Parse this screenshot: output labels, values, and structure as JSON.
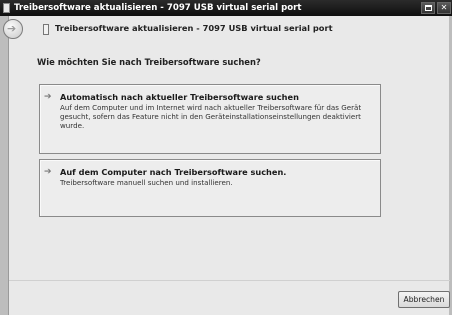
{
  "window": {
    "title": "Treibersoftware aktualisieren - 7097 USB virtual serial port"
  },
  "header": {
    "title": "Treibersoftware aktualisieren - 7097 USB virtual serial port"
  },
  "main": {
    "question": "Wie möchten Sie nach Treibersoftware suchen?",
    "options": [
      {
        "title": "Automatisch nach aktueller Treibersoftware suchen",
        "description": "Auf dem Computer und im Internet wird nach aktueller Treibersoftware für das Gerät gesucht, sofern das Feature nicht in den Geräteinstallationseinstellungen deaktiviert wurde."
      },
      {
        "title": "Auf dem Computer nach Treibersoftware suchen.",
        "description": "Treibersoftware manuell suchen und installieren."
      }
    ]
  },
  "footer": {
    "cancel_label": "Abbrechen"
  },
  "icons": {
    "back": "back-arrow-icon",
    "option_arrow": "right-arrow-icon",
    "app": "usb-device-icon",
    "maximize": "maximize-icon",
    "close": "close-icon"
  },
  "colors": {
    "titlebar": "#1a1a1a",
    "content_background": "#e9e9e9",
    "window_frame": "#bdbdbd"
  }
}
